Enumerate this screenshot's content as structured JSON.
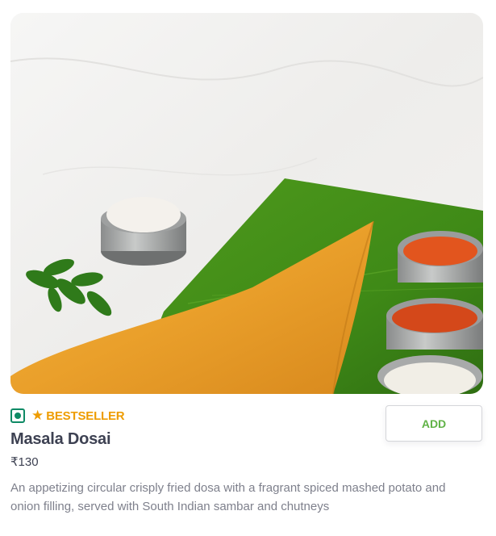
{
  "item": {
    "badge": "BESTSELLER",
    "name": "Masala Dosai",
    "price": "₹130",
    "description": "An appetizing circular crisply fried dosa with a fragrant spiced mashed potato and onion filling, served with South Indian sambar and chutneys"
  },
  "actions": {
    "add_label": "ADD"
  },
  "colors": {
    "bestseller": "#ee9c00",
    "veg": "#0f8a65",
    "add": "#60b246",
    "title": "#3d4152",
    "muted": "#7e808c"
  },
  "icons": {
    "veg": "veg-indicator-icon",
    "star": "star-icon"
  }
}
